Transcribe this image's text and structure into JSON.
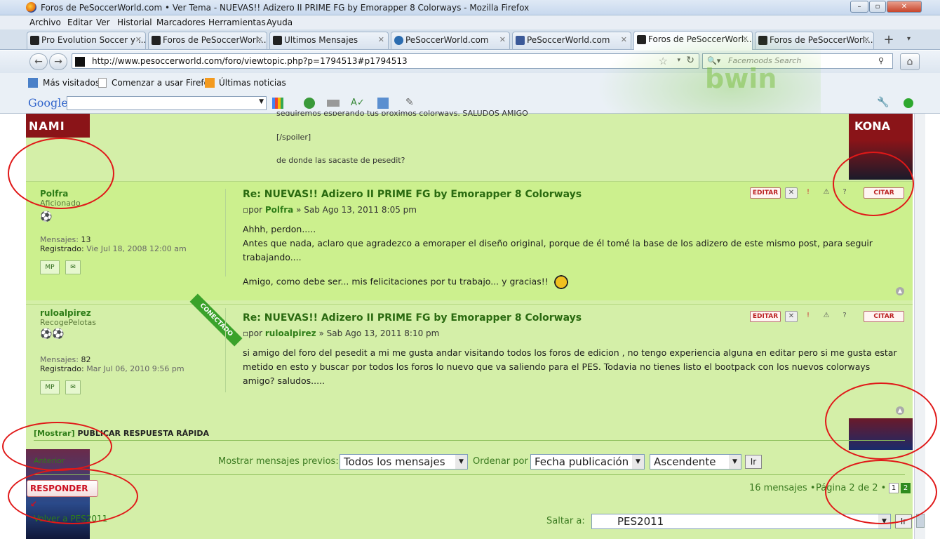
{
  "window": {
    "title": "Foros de PeSoccerWorld.com • Ver Tema - NUEVAS!! Adizero II PRIME FG by Emorapper 8 Colorways - Mozilla Firefox"
  },
  "menu": [
    "Archivo",
    "Editar",
    "Ver",
    "Historial",
    "Marcadores",
    "Herramientas",
    "Ayuda"
  ],
  "tabs": [
    {
      "label": "Pro Evolution Soccer y ...",
      "icon": "pes-icon"
    },
    {
      "label": "Foros de PeSoccerWorl...",
      "icon": "psw-icon"
    },
    {
      "label": "Ultimos Mensajes",
      "icon": "psw-icon"
    },
    {
      "label": "PeSoccerWorld.com",
      "icon": "pes-icon"
    },
    {
      "label": "PeSoccerWorld.com",
      "icon": "facebook-icon"
    },
    {
      "label": "Foros de PeSoccerWorl...",
      "icon": "psw-icon"
    },
    {
      "label": "Foros de PeSoccerWorl...",
      "icon": "psw-icon"
    }
  ],
  "nav": {
    "url": "http://www.pesoccerworld.com/foro/viewtopic.php?p=1794513#p1794513",
    "search_placeholder": "Facemoods Search"
  },
  "bookmarks": [
    "Más visitados",
    "Comenzar a usar Firefox",
    "Últimas noticias"
  ],
  "google": {
    "logo": "Google"
  },
  "banner": {
    "left": "NAMI",
    "right": "KONA",
    "brand": "bwin"
  },
  "prev_post": {
    "line1": "seguiremos esperando tus proximos colorways. SALUDOS AMIGO",
    "line2": "[/spoiler]",
    "line3": "de donde las sacaste de pesedit?"
  },
  "posts": [
    {
      "user": "Polfra",
      "rank": "Aficionado",
      "mensajes_label": "Mensajes:",
      "mensajes": "13",
      "registrado_label": "Registrado:",
      "registrado": "Vie Jul 18, 2008 12:00 am",
      "title": "Re: NUEVAS!! Adizero II PRIME FG by Emorapper 8 Colorways",
      "por": "por",
      "author": "Polfra",
      "date": "» Sab Ago 13, 2011 8:05 pm",
      "body": [
        "Ahhh, perdon.....",
        "Antes que nada, aclaro que agradezco a emoraper el diseño original, porque de él tomé la base de los adizero de este mismo post, para seguir trabajando....",
        "",
        "Amigo, como debe ser... mis felicitaciones por tu trabajo... y gracias!!"
      ]
    },
    {
      "user": "ruloalpirez",
      "rank": "RecogePelotas",
      "online": "CONECTADO",
      "mensajes_label": "Mensajes:",
      "mensajes": "82",
      "registrado_label": "Registrado:",
      "registrado": "Mar Jul 06, 2010 9:56 pm",
      "title": "Re: NUEVAS!! Adizero II PRIME FG by Emorapper 8 Colorways",
      "por": "por",
      "author": "ruloalpirez",
      "date": "» Sab Ago 13, 2011 8:10 pm",
      "body": [
        "si amigo del foro del pesedit a mi me gusta andar visitando todos los foros de edicion , no tengo experiencia alguna en editar pero si me gusta estar metido en esto y buscar por todos los foros lo nuevo que va saliendo para el PES. Todavia no tienes listo el bootpack con los nuevos colorways amigo? saludos....."
      ]
    }
  ],
  "buttons": {
    "editar": "EDITAR",
    "citar": "CITAR",
    "mp": "MP"
  },
  "quickreply": {
    "mostrar": "[Mostrar]",
    "label": "PUBLICAR RESPUESTA RÁPIDA"
  },
  "sort": {
    "show_label": "Mostrar mensajes previos:",
    "show_value": "Todos los mensajes",
    "order_label": "Ordenar por",
    "order_value": "Fecha publicación",
    "dir_value": "Ascendente",
    "go": "Ir"
  },
  "footer": {
    "responder": "RESPONDER",
    "anterior": "Anterior",
    "count": "16 mensajes •",
    "pagina": "Página 2 de 2 •",
    "page1": "1",
    "page2": "2",
    "volver": "Volver a PES2011",
    "saltar": "Saltar a:",
    "forum": "PES2011",
    "go": "Ir"
  },
  "colors": {
    "accent": "#2e7d18",
    "post_bg": "#ccf08e",
    "annotation": "#e01818"
  }
}
